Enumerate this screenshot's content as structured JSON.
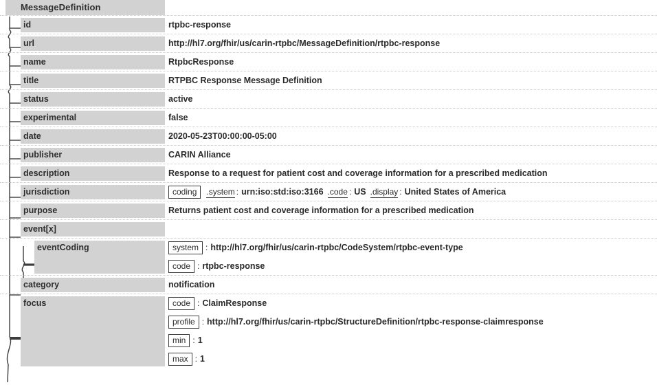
{
  "root": {
    "label": "MessageDefinition"
  },
  "rows": [
    {
      "name": "id",
      "label": "id",
      "value": "rtpbc-response"
    },
    {
      "name": "url",
      "label": "url",
      "value": "http://hl7.org/fhir/us/carin-rtpbc/MessageDefinition/rtpbc-response"
    },
    {
      "name": "name",
      "label": "name",
      "value": "RtpbcResponse"
    },
    {
      "name": "title",
      "label": "title",
      "value": "RTPBC Response Message Definition"
    },
    {
      "name": "status",
      "label": "status",
      "value": "active"
    },
    {
      "name": "experimental",
      "label": "experimental",
      "value": "false"
    },
    {
      "name": "date",
      "label": "date",
      "value": "2020-05-23T00:00:00-05:00"
    },
    {
      "name": "publisher",
      "label": "publisher",
      "value": "CARIN Alliance"
    },
    {
      "name": "description",
      "label": "description",
      "value": "Response to a request for patient cost and coverage information for a prescribed medication"
    }
  ],
  "jurisdiction": {
    "label": "jurisdiction",
    "coding_token": "coding",
    "system_key": ".system",
    "system_colon": ":",
    "system_value": "urn:iso:std:iso:3166",
    "code_key": ".code",
    "code_colon": ":",
    "code_value": "US",
    "display_key": ".display",
    "display_colon": ":",
    "display_value": "United States of America"
  },
  "purpose": {
    "label": "purpose",
    "value": "Returns patient cost and coverage information for a prescribed medication"
  },
  "event": {
    "label": "event[x]",
    "value": "",
    "child": {
      "label": "eventCoding",
      "system_token": "system",
      "system_colon": ":",
      "system_value": "http://hl7.org/fhir/us/carin-rtpbc/CodeSystem/rtpbc-event-type",
      "code_token": "code",
      "code_colon": ":",
      "code_value": "rtpbc-response"
    }
  },
  "category": {
    "label": "category",
    "value": "notification"
  },
  "focus": {
    "label": "focus",
    "code_token": "code",
    "code_colon": ":",
    "code_value": "ClaimResponse",
    "profile_token": "profile",
    "profile_colon": ":",
    "profile_value": "http://hl7.org/fhir/us/carin-rtpbc/StructureDefinition/rtpbc-response-claimresponse",
    "min_token": "min",
    "min_colon": ":",
    "min_value": "1",
    "max_token": "max",
    "max_colon": ":",
    "max_value": "1"
  },
  "colors": {
    "label_background": "#d2d2d2",
    "text": "#2a2a2a",
    "separator": "#c8c8c8",
    "connector": "#3c3c3c",
    "page_background": "#ffffff"
  }
}
